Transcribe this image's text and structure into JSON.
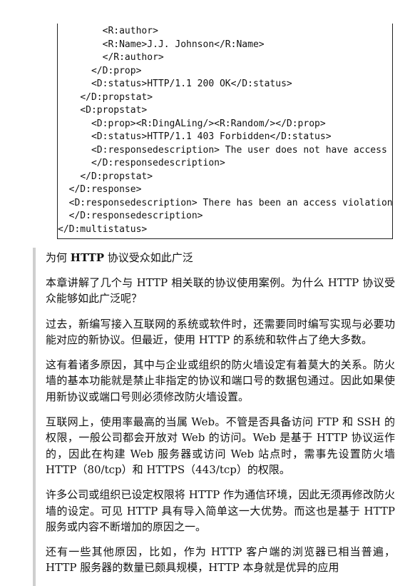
{
  "code": {
    "lines": [
      {
        "indent": "        ",
        "text": "<R:author>"
      },
      {
        "indent": "        ",
        "text": "<R:Name>J.J. Johnson</R:Name>"
      },
      {
        "indent": "        ",
        "text": "</R:author>"
      },
      {
        "indent": "      ",
        "text": "</D:prop>"
      },
      {
        "indent": "      ",
        "text": "<D:status>HTTP/1.1 200 OK</D:status>"
      },
      {
        "indent": "    ",
        "text": "</D:propstat>"
      },
      {
        "indent": "    ",
        "text": "<D:propstat>"
      },
      {
        "indent": "      ",
        "text": "<D:prop><R:DingALing/><R:Random/></D:prop>"
      },
      {
        "indent": "      ",
        "text": "<D:status>HTTP/1.1 403 Forbidden</D:status>"
      },
      {
        "indent": "      ",
        "text": "<D:responsedescription> The user does not have access to the DingALing property."
      },
      {
        "indent": "      ",
        "text": "</D:responsedescription>"
      },
      {
        "indent": "    ",
        "text": "</D:propstat>"
      },
      {
        "indent": "  ",
        "text": "</D:response>"
      },
      {
        "indent": "  ",
        "text": "<D:responsedescription> There has been an access violation error."
      },
      {
        "indent": "  ",
        "text": "</D:responsedescription>"
      },
      {
        "indent": "",
        "text": "</D:multistatus>"
      }
    ]
  },
  "article": {
    "title_prefix": "为何 ",
    "title_bold": "HTTP",
    "title_suffix": " 协议受众如此广泛",
    "paragraphs": [
      "本章讲解了几个与 HTTP 相关联的协议使用案例。为什么 HTTP 协议受众能够如此广泛呢？",
      "过去，新编写接入互联网的系统或软件时，还需要同时编写实现与必要功能对应的新协议。但最近，使用 HTTP 的系统和软件占了绝大多数。",
      "这有着诸多原因，其中与企业或组织的防火墙设定有着莫大的关系。防火墙的基本功能就是禁止非指定的协议和端口号的数据包通过。因此如果使用新协议或端口号则必须修改防火墙设置。",
      "互联网上，使用率最高的当属 Web。不管是否具备访问 FTP 和 SSH 的权限，一般公司都会开放对 Web 的访问。Web 是基于 HTTP 协议运作的，因此在构建 Web 服务器或访问 Web 站点时，需事先设置防火墙 HTTP（80/tcp）和 HTTPS（443/tcp）的权限。",
      "许多公司或组织已设定权限将 HTTP 作为通信环境，因此无须再修改防火墙的设定。可见 HTTP 具有导入简单这一大优势。而这也是基于 HTTP 服务或内容不断增加的原因之一。",
      "还有一些其他原因，比如，作为 HTTP 客户端的浏览器已相当普遍，HTTP 服务器的数量已颇具规模，HTTP 本身就是优异的应用"
    ]
  }
}
